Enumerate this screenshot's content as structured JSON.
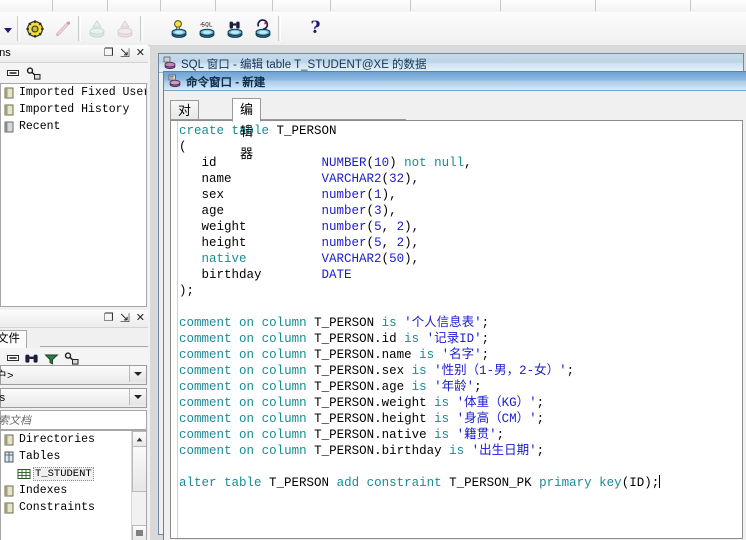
{
  "toolbar": {
    "buttons": [
      {
        "name": "dropdown-arrow",
        "icon": "chevron-down-icon",
        "label": ""
      },
      {
        "name": "gear-settings-button",
        "icon": "gear-icon",
        "label": ""
      },
      {
        "name": "wand-button",
        "icon": "wand-icon",
        "label": ""
      },
      {
        "name": "import-disabled-button",
        "icon": "database-import-icon",
        "label": ""
      },
      {
        "name": "export-disabled-button",
        "icon": "database-export-icon",
        "label": ""
      },
      {
        "name": "new-command-window-button",
        "icon": "bulb-database-icon",
        "label": ""
      },
      {
        "name": "new-sql-window-button",
        "icon": "sql-database-icon",
        "label": ""
      },
      {
        "name": "find-database-button",
        "icon": "binoculars-database-icon",
        "label": ""
      },
      {
        "name": "rollback-database-button",
        "icon": "undo-database-icon",
        "label": ""
      },
      {
        "name": "help-button",
        "icon": "question-mark-icon",
        "label": "?"
      }
    ]
  },
  "connections_panel": {
    "title": "ctions",
    "header_buttons": [
      "minimize-icon",
      "pin-icon",
      "close-icon"
    ],
    "toolbar_icons": [
      "collapse-icon",
      "key-user-icon"
    ],
    "items": [
      {
        "label": "Imported Fixed Users",
        "icon": "folder-icon"
      },
      {
        "label": "Imported History",
        "icon": "folder-icon"
      },
      {
        "label": "Recent",
        "icon": "folder-icon"
      }
    ]
  },
  "browser_panel": {
    "title": "",
    "header_buttons": [
      "minimize-icon",
      "pin-icon",
      "close-icon"
    ],
    "tabs": [
      {
        "label": "文件",
        "active": true
      }
    ],
    "toolbar_icons": [
      "collapse-icon",
      "binoculars-icon",
      "filter-icon",
      "key-user-icon"
    ],
    "user_combo": {
      "value": "用户>"
    },
    "objects_combo": {
      "value": "ects"
    },
    "search_input": {
      "placeholder": "搜索文档",
      "value": ""
    },
    "tree": [
      {
        "label": "Directories",
        "icon": "folder-icon",
        "indent": 0,
        "selected": false
      },
      {
        "label": "Tables",
        "icon": "table-folder-icon",
        "indent": 0,
        "selected": false
      },
      {
        "label": "T_STUDENT",
        "icon": "grid-table-icon",
        "indent": 1,
        "selected": true
      },
      {
        "label": "Indexes",
        "icon": "folder-icon",
        "indent": 0,
        "selected": false
      },
      {
        "label": "Constraints",
        "icon": "folder-icon",
        "indent": 0,
        "selected": false
      }
    ]
  },
  "background_window": {
    "title": "SQL 窗口 - 编辑 table T_STUDENT@XE 的数据",
    "icon": "sql-window-icon"
  },
  "command_window": {
    "title": "命令窗口 - 新建",
    "icon": "command-window-icon",
    "tabs": [
      {
        "label": "对话框",
        "active": false
      },
      {
        "label": "编辑器",
        "active": true
      }
    ]
  },
  "editor": {
    "lines": [
      [
        [
          "k",
          "create"
        ],
        [
          "n",
          " "
        ],
        [
          "k",
          "table"
        ],
        [
          "n",
          " T_PERSON"
        ]
      ],
      [
        [
          "n",
          "("
        ]
      ],
      [
        [
          "n",
          "   id              "
        ],
        [
          "t",
          "NUMBER"
        ],
        [
          "n",
          "("
        ],
        [
          "t",
          "10"
        ],
        [
          "n",
          ") "
        ],
        [
          "k",
          "not"
        ],
        [
          "n",
          " "
        ],
        [
          "k",
          "null"
        ],
        [
          "n",
          ","
        ]
      ],
      [
        [
          "n",
          "   name            "
        ],
        [
          "t",
          "VARCHAR2"
        ],
        [
          "n",
          "("
        ],
        [
          "t",
          "32"
        ],
        [
          "n",
          "),"
        ]
      ],
      [
        [
          "n",
          "   sex             "
        ],
        [
          "t",
          "number"
        ],
        [
          "n",
          "("
        ],
        [
          "t",
          "1"
        ],
        [
          "n",
          "),"
        ]
      ],
      [
        [
          "n",
          "   age             "
        ],
        [
          "t",
          "number"
        ],
        [
          "n",
          "("
        ],
        [
          "t",
          "3"
        ],
        [
          "n",
          "),"
        ]
      ],
      [
        [
          "n",
          "   weight          "
        ],
        [
          "t",
          "number"
        ],
        [
          "n",
          "("
        ],
        [
          "t",
          "5"
        ],
        [
          "n",
          ", "
        ],
        [
          "t",
          "2"
        ],
        [
          "n",
          "),"
        ]
      ],
      [
        [
          "n",
          "   height          "
        ],
        [
          "t",
          "number"
        ],
        [
          "n",
          "("
        ],
        [
          "t",
          "5"
        ],
        [
          "n",
          ", "
        ],
        [
          "t",
          "2"
        ],
        [
          "n",
          "),"
        ]
      ],
      [
        [
          "k",
          "   native"
        ],
        [
          "n",
          "          "
        ],
        [
          "t",
          "VARCHAR2"
        ],
        [
          "n",
          "("
        ],
        [
          "t",
          "50"
        ],
        [
          "n",
          "),"
        ]
      ],
      [
        [
          "n",
          "   birthday        "
        ],
        [
          "t",
          "DATE"
        ]
      ],
      [
        [
          "n",
          ");"
        ]
      ],
      [
        [
          "n",
          ""
        ]
      ],
      [
        [
          "k",
          "comment"
        ],
        [
          "n",
          " "
        ],
        [
          "k",
          "on"
        ],
        [
          "n",
          " "
        ],
        [
          "k",
          "column"
        ],
        [
          "n",
          " T_PERSON "
        ],
        [
          "k",
          "is"
        ],
        [
          "n",
          " "
        ],
        [
          "s",
          "'个人信息表'"
        ],
        [
          "n",
          ";"
        ]
      ],
      [
        [
          "k",
          "comment"
        ],
        [
          "n",
          " "
        ],
        [
          "k",
          "on"
        ],
        [
          "n",
          " "
        ],
        [
          "k",
          "column"
        ],
        [
          "n",
          " T_PERSON.id "
        ],
        [
          "k",
          "is"
        ],
        [
          "n",
          " "
        ],
        [
          "s",
          "'记录ID'"
        ],
        [
          "n",
          ";"
        ]
      ],
      [
        [
          "k",
          "comment"
        ],
        [
          "n",
          " "
        ],
        [
          "k",
          "on"
        ],
        [
          "n",
          " "
        ],
        [
          "k",
          "column"
        ],
        [
          "n",
          " T_PERSON.name "
        ],
        [
          "k",
          "is"
        ],
        [
          "n",
          " "
        ],
        [
          "s",
          "'名字'"
        ],
        [
          "n",
          ";"
        ]
      ],
      [
        [
          "k",
          "comment"
        ],
        [
          "n",
          " "
        ],
        [
          "k",
          "on"
        ],
        [
          "n",
          " "
        ],
        [
          "k",
          "column"
        ],
        [
          "n",
          " T_PERSON.sex "
        ],
        [
          "k",
          "is"
        ],
        [
          "n",
          " "
        ],
        [
          "s",
          "'性别（1-男，2-女）'"
        ],
        [
          "n",
          ";"
        ]
      ],
      [
        [
          "k",
          "comment"
        ],
        [
          "n",
          " "
        ],
        [
          "k",
          "on"
        ],
        [
          "n",
          " "
        ],
        [
          "k",
          "column"
        ],
        [
          "n",
          " T_PERSON.age "
        ],
        [
          "k",
          "is"
        ],
        [
          "n",
          " "
        ],
        [
          "s",
          "'年龄'"
        ],
        [
          "n",
          ";"
        ]
      ],
      [
        [
          "k",
          "comment"
        ],
        [
          "n",
          " "
        ],
        [
          "k",
          "on"
        ],
        [
          "n",
          " "
        ],
        [
          "k",
          "column"
        ],
        [
          "n",
          " T_PERSON.weight "
        ],
        [
          "k",
          "is"
        ],
        [
          "n",
          " "
        ],
        [
          "s",
          "'体重（KG）'"
        ],
        [
          "n",
          ";"
        ]
      ],
      [
        [
          "k",
          "comment"
        ],
        [
          "n",
          " "
        ],
        [
          "k",
          "on"
        ],
        [
          "n",
          " "
        ],
        [
          "k",
          "column"
        ],
        [
          "n",
          " T_PERSON.height "
        ],
        [
          "k",
          "is"
        ],
        [
          "n",
          " "
        ],
        [
          "s",
          "'身高（CM）'"
        ],
        [
          "n",
          ";"
        ]
      ],
      [
        [
          "k",
          "comment"
        ],
        [
          "n",
          " "
        ],
        [
          "k",
          "on"
        ],
        [
          "n",
          " "
        ],
        [
          "k",
          "column"
        ],
        [
          "n",
          " T_PERSON.native "
        ],
        [
          "k",
          "is"
        ],
        [
          "n",
          " "
        ],
        [
          "s",
          "'籍贯'"
        ],
        [
          "n",
          ";"
        ]
      ],
      [
        [
          "k",
          "comment"
        ],
        [
          "n",
          " "
        ],
        [
          "k",
          "on"
        ],
        [
          "n",
          " "
        ],
        [
          "k",
          "column"
        ],
        [
          "n",
          " T_PERSON.birthday "
        ],
        [
          "k",
          "is"
        ],
        [
          "n",
          " "
        ],
        [
          "s",
          "'出生日期'"
        ],
        [
          "n",
          ";"
        ]
      ],
      [
        [
          "n",
          ""
        ]
      ],
      [
        [
          "k",
          "alter"
        ],
        [
          "n",
          " "
        ],
        [
          "k",
          "table"
        ],
        [
          "n",
          " T_PERSON "
        ],
        [
          "k",
          "add"
        ],
        [
          "n",
          " "
        ],
        [
          "k",
          "constraint"
        ],
        [
          "n",
          " T_PERSON_PK "
        ],
        [
          "k",
          "primary"
        ],
        [
          "n",
          " "
        ],
        [
          "k",
          "key"
        ],
        [
          "n",
          "(ID);"
        ],
        [
          "caret",
          ""
        ]
      ]
    ]
  },
  "colors": {
    "keyword": "#1a8a95",
    "datatype": "#1b1bd0",
    "string": "#1b1bd0",
    "identifier": "#000000",
    "title_active": "#8cb8e0",
    "title_inactive": "#bcd4e6"
  }
}
